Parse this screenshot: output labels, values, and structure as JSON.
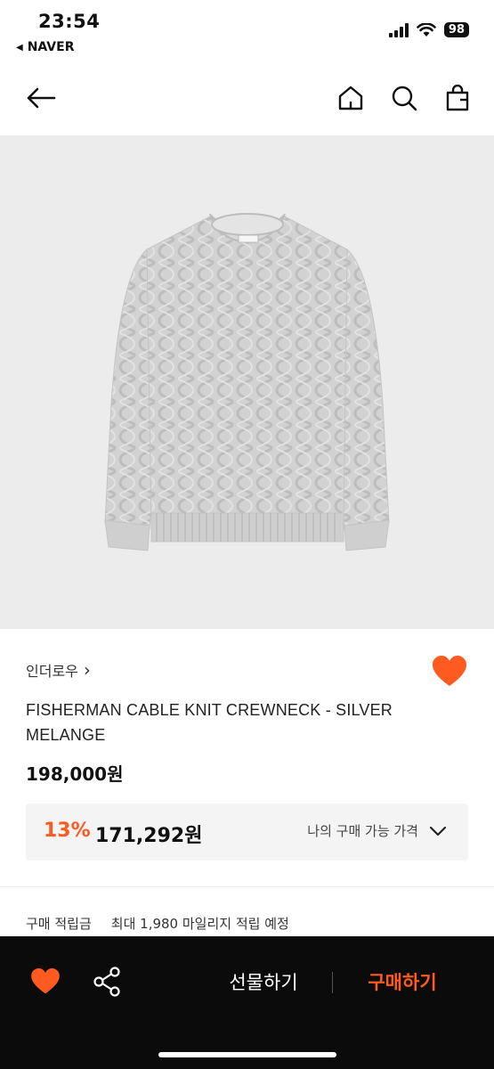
{
  "status_bar": {
    "time": "23:54",
    "back_app": "NAVER",
    "battery": "98"
  },
  "nav": {
    "back_icon": "back-arrow-icon",
    "home_icon": "home-icon",
    "search_icon": "search-icon",
    "cart_icon": "shopping-bag-icon"
  },
  "product": {
    "image_icon": "sweater-image",
    "brand": "인더로우",
    "brand_chevron": "›",
    "name": "FISHERMAN CABLE KNIT CREWNECK - SILVER MELANGE",
    "original_price": "198,000원",
    "discount_rate": "13%",
    "sale_price": "171,292원",
    "my_price_label": "나의 구매 가능 가격",
    "points_label": "구매 적립금",
    "points_text": "최대 1,980 마일리지 적립 예정"
  },
  "bottom_bar": {
    "gift_label": "선물하기",
    "buy_label": "구매하기"
  },
  "colors": {
    "accent": "#ff5a1f",
    "bar_bg": "#0b0b0b",
    "image_bg": "#ececec"
  }
}
